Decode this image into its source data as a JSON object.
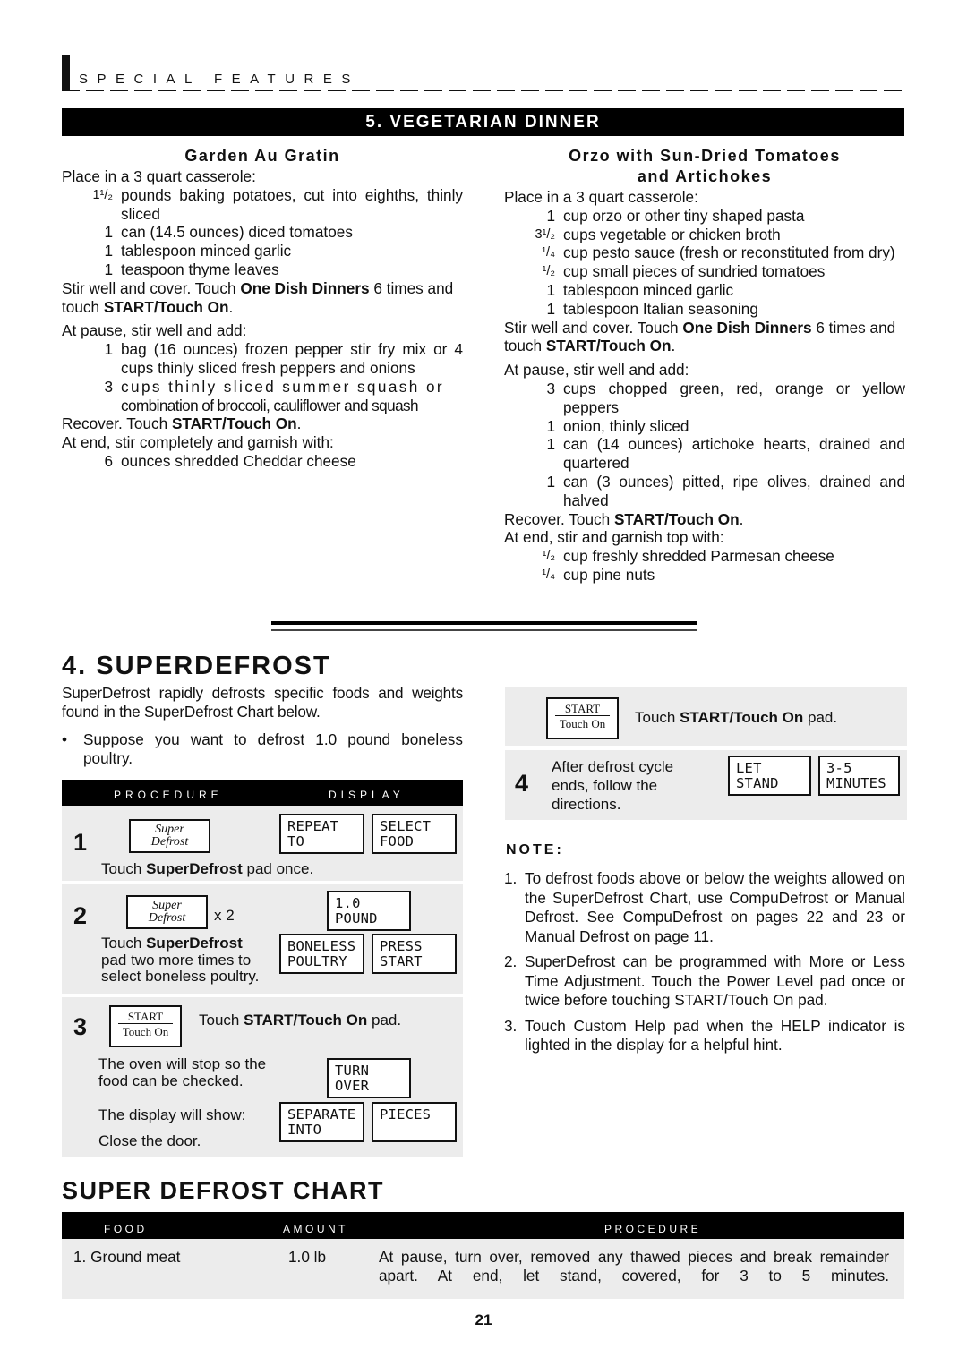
{
  "header": {
    "section": "SPECIAL FEATURES",
    "banner": "5. VEGETARIAN DINNER"
  },
  "recipe_left": {
    "title": "Garden Au Gratin",
    "intro": "Place in a 3 quart casserole:",
    "ingredients1": [
      {
        "qty": "1¹/₂",
        "text": "pounds baking potatoes, cut into eighths, thinly sliced"
      },
      {
        "qty": "1",
        "text": "can (14.5 ounces) diced tomatoes"
      },
      {
        "qty": "1",
        "text": "tablespoon minced garlic"
      },
      {
        "qty": "1",
        "text": "teaspoon thyme leaves"
      }
    ],
    "step1_pre": "Stir well and cover. Touch ",
    "step1_bold1": "One Dish Dinners",
    "step1_mid": " 6 times and touch ",
    "step1_bold2": "START/Touch On",
    "step1_end": ".",
    "pause": "At pause, stir well and add:",
    "ingredients2": [
      {
        "qty": "1",
        "text": "bag (16 ounces) frozen pepper stir fry mix or 4 cups thinly sliced fresh peppers and onions"
      },
      {
        "qty": "3",
        "text": "cups thinly sliced summer squash or"
      },
      {
        "qty": "",
        "text": "combination of broccoli, cauliflower and squash"
      }
    ],
    "recover_pre": "Recover. Touch ",
    "recover_bold": "START/Touch On",
    "recover_end": ".",
    "end": "At end, stir completely and  garnish with:",
    "ingredients3": [
      {
        "qty": "6",
        "text": "ounces shredded Cheddar cheese"
      }
    ]
  },
  "recipe_right": {
    "title_line1": "Orzo with Sun-Dried Tomatoes",
    "title_line2": "and Artichokes",
    "intro": "Place in a 3 quart casserole:",
    "ingredients1": [
      {
        "qty": "1",
        "text": "cup orzo or other tiny shaped pasta"
      },
      {
        "qty": "3¹/₂",
        "text": "cups vegetable or chicken broth"
      },
      {
        "qty": "¹/₄",
        "text": "cup pesto sauce (fresh or reconstituted from dry)"
      },
      {
        "qty": "¹/₂",
        "text": "cup small pieces of sundried tomatoes"
      },
      {
        "qty": "1",
        "text": "tablespoon minced garlic"
      },
      {
        "qty": "1",
        "text": "tablespoon Italian seasoning"
      }
    ],
    "step1_pre": "Stir well and cover. Touch ",
    "step1_bold1": "One Dish Dinners",
    "step1_mid": " 6 times and touch ",
    "step1_bold2": "START/Touch On",
    "step1_end": ".",
    "pause": "At pause, stir well and add:",
    "ingredients2": [
      {
        "qty": "3",
        "text": "cups chopped green, red, orange or yellow peppers"
      },
      {
        "qty": "1",
        "text": "onion, thinly sliced"
      },
      {
        "qty": "1",
        "text": "can (14 ounces) artichoke hearts, drained and quartered"
      },
      {
        "qty": "1",
        "text": "can (3 ounces) pitted, ripe olives, drained and halved"
      }
    ],
    "recover_pre": "Recover. Touch ",
    "recover_bold": "START/Touch On",
    "recover_end": ".",
    "end": "At end, stir and garnish top with:",
    "ingredients3": [
      {
        "qty": "¹/₂",
        "text": "cup freshly shredded Parmesan cheese"
      },
      {
        "qty": "¹/₄",
        "text": "cup pine nuts"
      }
    ]
  },
  "superdefrost": {
    "title": "4. SUPERDEFROST",
    "intro": "SuperDefrost rapidly defrosts specific foods and weights found in the SuperDefrost Chart below.",
    "bullet": "Suppose you want to defrost 1.0 pound boneless poultry.",
    "bullet_mark": "•",
    "proc_header": "PROCEDURE",
    "display_header": "DISPLAY",
    "pads": {
      "super_line1": "Super",
      "super_line2": "Defrost",
      "start_line1": "START",
      "start_line2": "Touch On"
    },
    "steps": [
      {
        "num": "1",
        "text_pre": "Touch ",
        "text_bold": "SuperDefrost",
        "text_post": " pad once.",
        "displays": [
          "REPEAT\nTO",
          "SELECT\nFOOD"
        ]
      },
      {
        "num": "2",
        "multiplier": "x 2",
        "text_pre": "Touch ",
        "text_bold": "SuperDefrost",
        "text_post": "pad two more times to select boneless poultry.",
        "displays": [
          "1.0\nPOUND",
          "BONELESS\nPOULTRY",
          "PRESS\nSTART"
        ]
      },
      {
        "num": "3",
        "text_pre": "Touch ",
        "text_bold": "START/Touch On",
        "text_post": " pad.",
        "detail1": "The oven will stop so the food can be checked.",
        "detail2": "The display will show:",
        "detail3": "Close the door.",
        "displays": [
          "TURN\nOVER",
          "SEPARATE\nINTO",
          "PIECES"
        ]
      },
      {
        "num": "",
        "text_pre": "Touch ",
        "text_bold": "START/Touch On",
        "text_post": " pad."
      },
      {
        "num": "4",
        "text": "After defrost cycle ends, follow the directions.",
        "displays": [
          "LET\nSTAND",
          "3-5\nMINUTES"
        ]
      }
    ]
  },
  "notes": {
    "heading": "NOTE:",
    "items": [
      {
        "n": "1.",
        "text": "To defrost foods above or below the weights allowed on the SuperDefrost Chart, use CompuDefrost or Manual Defrost. See CompuDefrost on pages 22 and 23 or Manual Defrost on page 11."
      },
      {
        "n": "2.",
        "text": "SuperDefrost can be programmed with More or Less Time Adjustment. Touch the Power Level pad once or twice before touching START/Touch On pad."
      },
      {
        "n": "3.",
        "text": "Touch Custom Help pad when the HELP indicator is lighted in the display for a helpful hint."
      }
    ]
  },
  "chart": {
    "title": "SUPER DEFROST CHART",
    "columns": [
      "FOOD",
      "AMOUNT",
      "PROCEDURE"
    ],
    "rows": [
      {
        "food": "1. Ground meat",
        "amount": "1.0 lb",
        "procedure": "At pause, turn over, removed any thawed pieces and break remainder apart. At end, let stand, covered, for 3 to 5 minutes."
      }
    ]
  },
  "page_number": "21"
}
